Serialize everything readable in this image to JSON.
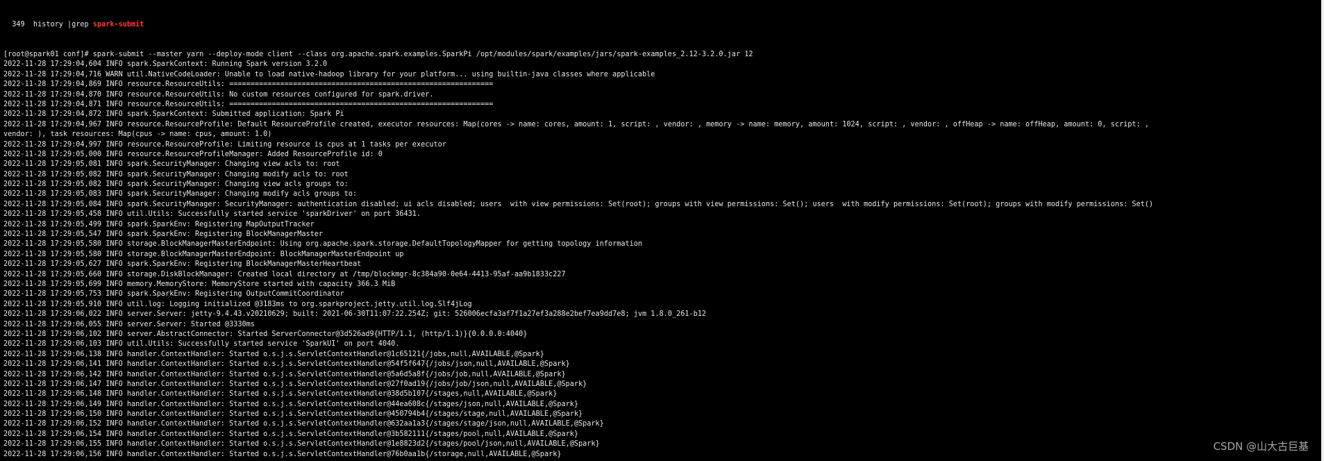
{
  "terminal": {
    "history_line": {
      "prefix": "  349  history |grep ",
      "highlight": "spark-submit",
      "highlight_color": "#ff3b3b"
    },
    "lines": [
      "[root@spark01 conf]# spark-submit --master yarn --deploy-mode client --class org.apache.spark.examples.SparkPi /opt/modules/spark/examples/jars/spark-examples_2.12-3.2.0.jar 12",
      "2022-11-28 17:29:04,604 INFO spark.SparkContext: Running Spark version 3.2.0",
      "2022-11-28 17:29:04,716 WARN util.NativeCodeLoader: Unable to load native-hadoop library for your platform... using builtin-java classes where applicable",
      "2022-11-28 17:29:04,869 INFO resource.ResourceUtils: ==============================================================",
      "2022-11-28 17:29:04,870 INFO resource.ResourceUtils: No custom resources configured for spark.driver.",
      "2022-11-28 17:29:04,871 INFO resource.ResourceUtils: ==============================================================",
      "2022-11-28 17:29:04,872 INFO spark.SparkContext: Submitted application: Spark Pi",
      "2022-11-28 17:29:04,967 INFO resource.ResourceProfile: Default ResourceProfile created, executor resources: Map(cores -> name: cores, amount: 1, script: , vendor: , memory -> name: memory, amount: 1024, script: , vendor: , offHeap -> name: offHeap, amount: 0, script: ,",
      "vendor: ), task resources: Map(cpus -> name: cpus, amount: 1.0)",
      "2022-11-28 17:29:04,997 INFO resource.ResourceProfile: Limiting resource is cpus at 1 tasks per executor",
      "2022-11-28 17:29:05,000 INFO resource.ResourceProfileManager: Added ResourceProfile id: 0",
      "2022-11-28 17:29:05,081 INFO spark.SecurityManager: Changing view acls to: root",
      "2022-11-28 17:29:05,082 INFO spark.SecurityManager: Changing modify acls to: root",
      "2022-11-28 17:29:05,082 INFO spark.SecurityManager: Changing view acls groups to: ",
      "2022-11-28 17:29:05,083 INFO spark.SecurityManager: Changing modify acls groups to: ",
      "2022-11-28 17:29:05,084 INFO spark.SecurityManager: SecurityManager: authentication disabled; ui acls disabled; users  with view permissions: Set(root); groups with view permissions: Set(); users  with modify permissions: Set(root); groups with modify permissions: Set()",
      "2022-11-28 17:29:05,458 INFO util.Utils: Successfully started service 'sparkDriver' on port 36431.",
      "2022-11-28 17:29:05,499 INFO spark.SparkEnv: Registering MapOutputTracker",
      "2022-11-28 17:29:05,547 INFO spark.SparkEnv: Registering BlockManagerMaster",
      "2022-11-28 17:29:05,580 INFO storage.BlockManagerMasterEndpoint: Using org.apache.spark.storage.DefaultTopologyMapper for getting topology information",
      "2022-11-28 17:29:05,580 INFO storage.BlockManagerMasterEndpoint: BlockManagerMasterEndpoint up",
      "2022-11-28 17:29:05,627 INFO spark.SparkEnv: Registering BlockManagerMasterHeartbeat",
      "2022-11-28 17:29:05,660 INFO storage.DiskBlockManager: Created local directory at /tmp/blockmgr-8c384a90-0e64-4413-95af-aa9b1833c227",
      "2022-11-28 17:29:05,699 INFO memory.MemoryStore: MemoryStore started with capacity 366.3 MiB",
      "2022-11-28 17:29:05,753 INFO spark.SparkEnv: Registering OutputCommitCoordinator",
      "2022-11-28 17:29:05,910 INFO util.log: Logging initialized @3183ms to org.sparkproject.jetty.util.log.Slf4jLog",
      "2022-11-28 17:29:06,022 INFO server.Server: jetty-9.4.43.v20210629; built: 2021-06-30T11:07:22.254Z; git: 526006ecfa3af7f1a27ef3a288e2bef7ea9dd7e8; jvm 1.8.0_261-b12",
      "2022-11-28 17:29:06,055 INFO server.Server: Started @3330ms",
      "2022-11-28 17:29:06,102 INFO server.AbstractConnector: Started ServerConnector@3d526ad9{HTTP/1.1, (http/1.1)}{0.0.0.0:4040}",
      "2022-11-28 17:29:06,103 INFO util.Utils: Successfully started service 'SparkUI' on port 4040.",
      "2022-11-28 17:29:06,138 INFO handler.ContextHandler: Started o.s.j.s.ServletContextHandler@1c65121{/jobs,null,AVAILABLE,@Spark}",
      "2022-11-28 17:29:06,141 INFO handler.ContextHandler: Started o.s.j.s.ServletContextHandler@54f5f647{/jobs/json,null,AVAILABLE,@Spark}",
      "2022-11-28 17:29:06,142 INFO handler.ContextHandler: Started o.s.j.s.ServletContextHandler@5a6d5a8f{/jobs/job,null,AVAILABLE,@Spark}",
      "2022-11-28 17:29:06,147 INFO handler.ContextHandler: Started o.s.j.s.ServletContextHandler@27f0ad19{/jobs/job/json,null,AVAILABLE,@Spark}",
      "2022-11-28 17:29:06,148 INFO handler.ContextHandler: Started o.s.j.s.ServletContextHandler@38d5b107{/stages,null,AVAILABLE,@Spark}",
      "2022-11-28 17:29:06,149 INFO handler.ContextHandler: Started o.s.j.s.ServletContextHandler@44ea608c{/stages/json,null,AVAILABLE,@Spark}",
      "2022-11-28 17:29:06,150 INFO handler.ContextHandler: Started o.s.j.s.ServletContextHandler@450794b4{/stages/stage,null,AVAILABLE,@Spark}",
      "2022-11-28 17:29:06,152 INFO handler.ContextHandler: Started o.s.j.s.ServletContextHandler@632aa1a3{/stages/stage/json,null,AVAILABLE,@Spark}",
      "2022-11-28 17:29:06,154 INFO handler.ContextHandler: Started o.s.j.s.ServletContextHandler@3b582111{/stages/pool,null,AVAILABLE,@Spark}",
      "2022-11-28 17:29:06,155 INFO handler.ContextHandler: Started o.s.j.s.ServletContextHandler@1e8823d2{/stages/pool/json,null,AVAILABLE,@Spark}",
      "2022-11-28 17:29:06,156 INFO handler.ContextHandler: Started o.s.j.s.ServletContextHandler@76b0aa1b{/storage,null,AVAILABLE,@Spark}"
    ]
  },
  "watermark": "CSDN @山大古巨基"
}
